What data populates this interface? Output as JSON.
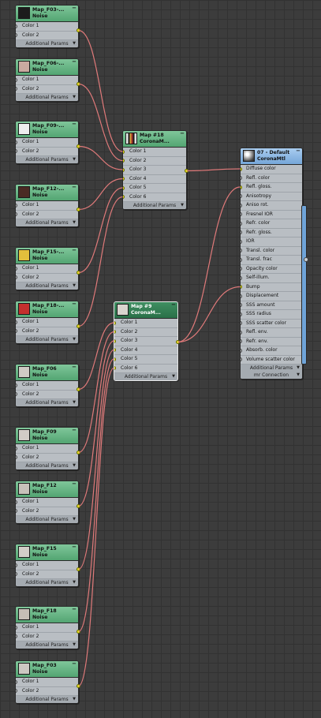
{
  "wire_color": "#e07a7a",
  "socket_on_color": "#e8f01c",
  "noise_nodes": [
    {
      "title": "Map_F03-...",
      "type": "Noise",
      "swatch": "#1c1c1c",
      "inputs": [
        "Color 1",
        "Color 2"
      ],
      "footer": "Additional Params"
    },
    {
      "title": "Map_F06-...",
      "type": "Noise",
      "swatch": "#c9aaa0",
      "inputs": [
        "Color 1",
        "Color 2"
      ],
      "footer": "Additional Params"
    },
    {
      "title": "Map_F09-...",
      "type": "Noise",
      "swatch": "#eeeeee",
      "inputs": [
        "Color 1",
        "Color 2"
      ],
      "footer": "Additional Params"
    },
    {
      "title": "Map_F12-...",
      "type": "Noise",
      "swatch": "#4a2b24",
      "inputs": [
        "Color 1",
        "Color 2"
      ],
      "footer": "Additional Params"
    },
    {
      "title": "Map_F15-...",
      "type": "Noise",
      "swatch": "#e3bf3c",
      "inputs": [
        "Color 1",
        "Color 2"
      ],
      "footer": "Additional Params"
    },
    {
      "title": "Map_F18-...",
      "type": "Noise",
      "swatch": "#c4302e",
      "inputs": [
        "Color 1",
        "Color 2"
      ],
      "footer": "Additional Params"
    },
    {
      "title": "Map_F06",
      "type": "Noise",
      "swatch": "#cfcac4",
      "inputs": [
        "Color 1",
        "Color 2"
      ],
      "footer": "Additional Params"
    },
    {
      "title": "Map_F09",
      "type": "Noise",
      "swatch": "#d1ccc6",
      "inputs": [
        "Color 1",
        "Color 2"
      ],
      "footer": "Additional Params"
    },
    {
      "title": "Map_F12",
      "type": "Noise",
      "swatch": "#c8c1ba",
      "inputs": [
        "Color 1",
        "Color 2"
      ],
      "footer": "Additional Params"
    },
    {
      "title": "Map_F15",
      "type": "Noise",
      "swatch": "#d3cec8",
      "inputs": [
        "Color 1",
        "Color 2"
      ],
      "footer": "Additional Params"
    },
    {
      "title": "Map_F18",
      "type": "Noise",
      "swatch": "#c6beb6",
      "inputs": [
        "Color 1",
        "Color 2"
      ],
      "footer": "Additional Params"
    },
    {
      "title": "Map_F03",
      "type": "Noise",
      "swatch": "#cdc8c2",
      "inputs": [
        "Color 1",
        "Color 2"
      ],
      "footer": "Additional Params"
    }
  ],
  "mix_nodes": [
    {
      "title": "Map #18",
      "type": "CoronaM...",
      "inputs": [
        "Color 1",
        "Color 2",
        "Color 3",
        "Color 4",
        "Color 5",
        "Color 6"
      ],
      "footer": "Additional Params",
      "selected": false
    },
    {
      "title": "Map #9",
      "type": "CoronaM...",
      "inputs": [
        "Color 1",
        "Color 2",
        "Color 3",
        "Color 4",
        "Color 5",
        "Color 6"
      ],
      "footer": "Additional Params",
      "selected": true
    }
  ],
  "material_node": {
    "title": "07 - Default",
    "type": "CoronaMtl",
    "slots": [
      "Diffuse color",
      "Refl. color",
      "Refl. gloss.",
      "Anisotropy",
      "Aniso rot.",
      "Fresnel IOR",
      "Refr. color",
      "Refr. gloss.",
      "IOR",
      "Transl. color",
      "Transl. frac",
      "Opacity color",
      "Self-illum.",
      "Bump",
      "Displacement",
      "SSS amount",
      "SSS radius",
      "SSS scatter color",
      "Refl. env.",
      "Refr. env.",
      "Absorb. color",
      "Volume scatter color"
    ],
    "active_slots": [
      0,
      2,
      13
    ],
    "footer": "Additional Params",
    "footer2": "mr Connection"
  }
}
